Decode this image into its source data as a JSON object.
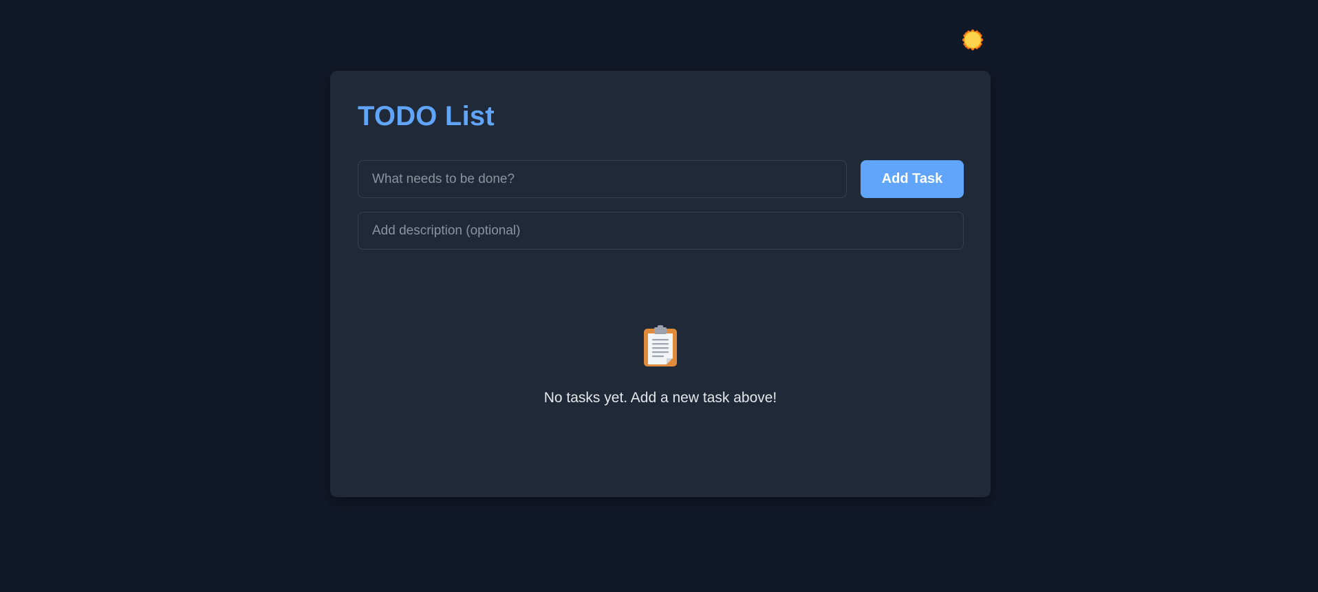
{
  "header": {
    "theme_toggle_icon": "sun-icon"
  },
  "card": {
    "title": "TODO List",
    "task_input": {
      "placeholder": "What needs to be done?",
      "value": ""
    },
    "add_button_label": "Add Task",
    "description_input": {
      "placeholder": "Add description (optional)",
      "value": ""
    },
    "empty_state": {
      "icon": "clipboard-icon",
      "message": "No tasks yet. Add a new task above!"
    }
  },
  "colors": {
    "background": "#111827",
    "card": "#1f2937",
    "accent": "#60a5fa",
    "text": "#e5e7eb",
    "sun": "#fbbf24"
  }
}
